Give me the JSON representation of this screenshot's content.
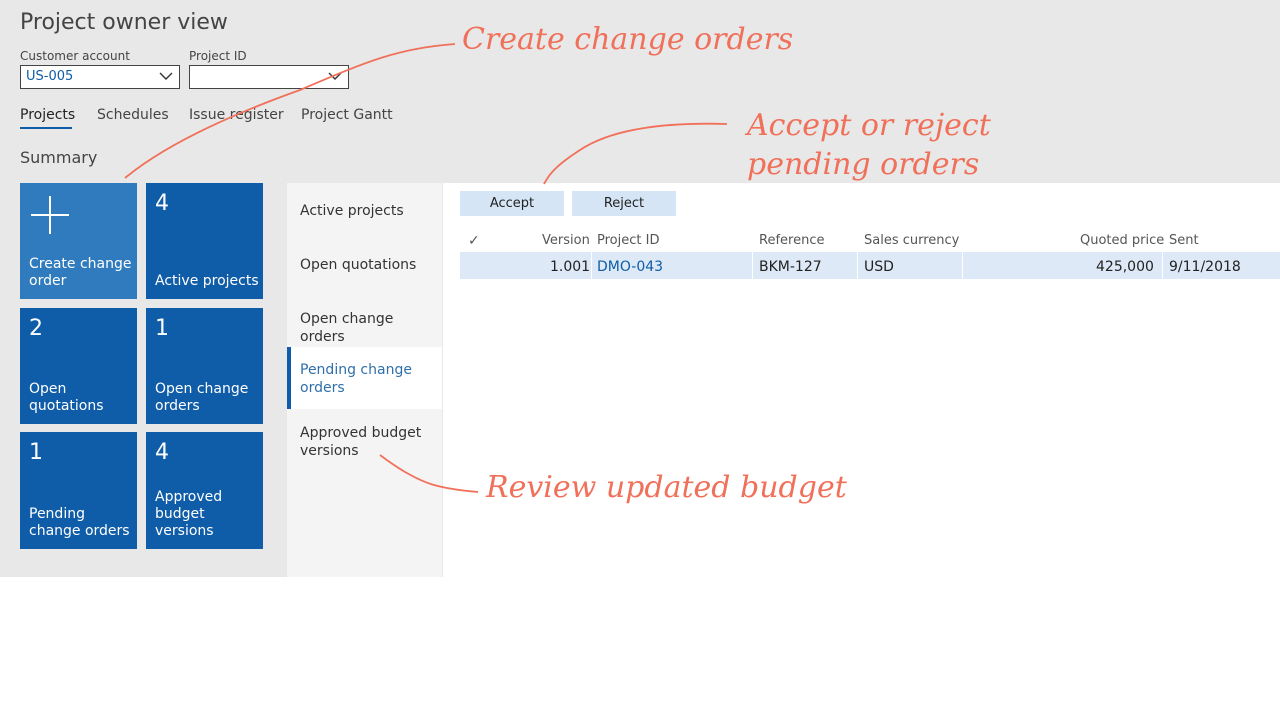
{
  "page": {
    "title": "Project owner view"
  },
  "filters": {
    "customer_account": {
      "label": "Customer account",
      "value": "US-005"
    },
    "project_id": {
      "label": "Project ID",
      "value": ""
    }
  },
  "tabs": [
    "Projects",
    "Schedules",
    "Issue register",
    "Project Gantt"
  ],
  "summary_label": "Summary",
  "tiles": [
    {
      "number": "",
      "label": "Create change order",
      "icon": "plus-icon"
    },
    {
      "number": "4",
      "label": "Active projects"
    },
    {
      "number": "2",
      "label": "Open quotations"
    },
    {
      "number": "1",
      "label": "Open change orders"
    },
    {
      "number": "1",
      "label": "Pending change orders"
    },
    {
      "number": "4",
      "label": "Approved budget versions"
    }
  ],
  "nav": [
    "Active projects",
    "Open quotations",
    "Open change orders",
    "Pending change orders",
    "Approved budget versions"
  ],
  "nav_active": "Pending change orders",
  "actions": {
    "accept": "Accept",
    "reject": "Reject"
  },
  "grid": {
    "headers": {
      "check": "✓",
      "version": "Version",
      "project_id": "Project ID",
      "reference": "Reference",
      "currency": "Sales currency",
      "quoted_price": "Quoted price",
      "sent": "Sent"
    },
    "rows": [
      {
        "version": "1.001",
        "project_id": "DMO-043",
        "reference": "BKM-127",
        "currency": "USD",
        "quoted_price": "425,000",
        "sent": "9/11/2018"
      }
    ]
  },
  "annotations": {
    "create": "Create change orders",
    "accept_1": "Accept or reject",
    "accept_2": "pending orders",
    "review": "Review updated budget"
  },
  "colors": {
    "accent": "#0f5ca8",
    "tile_light": "#2f7bbd",
    "annotation": "#f0705a",
    "row_selected": "#dde9f6",
    "button": "#d5e5f5"
  }
}
